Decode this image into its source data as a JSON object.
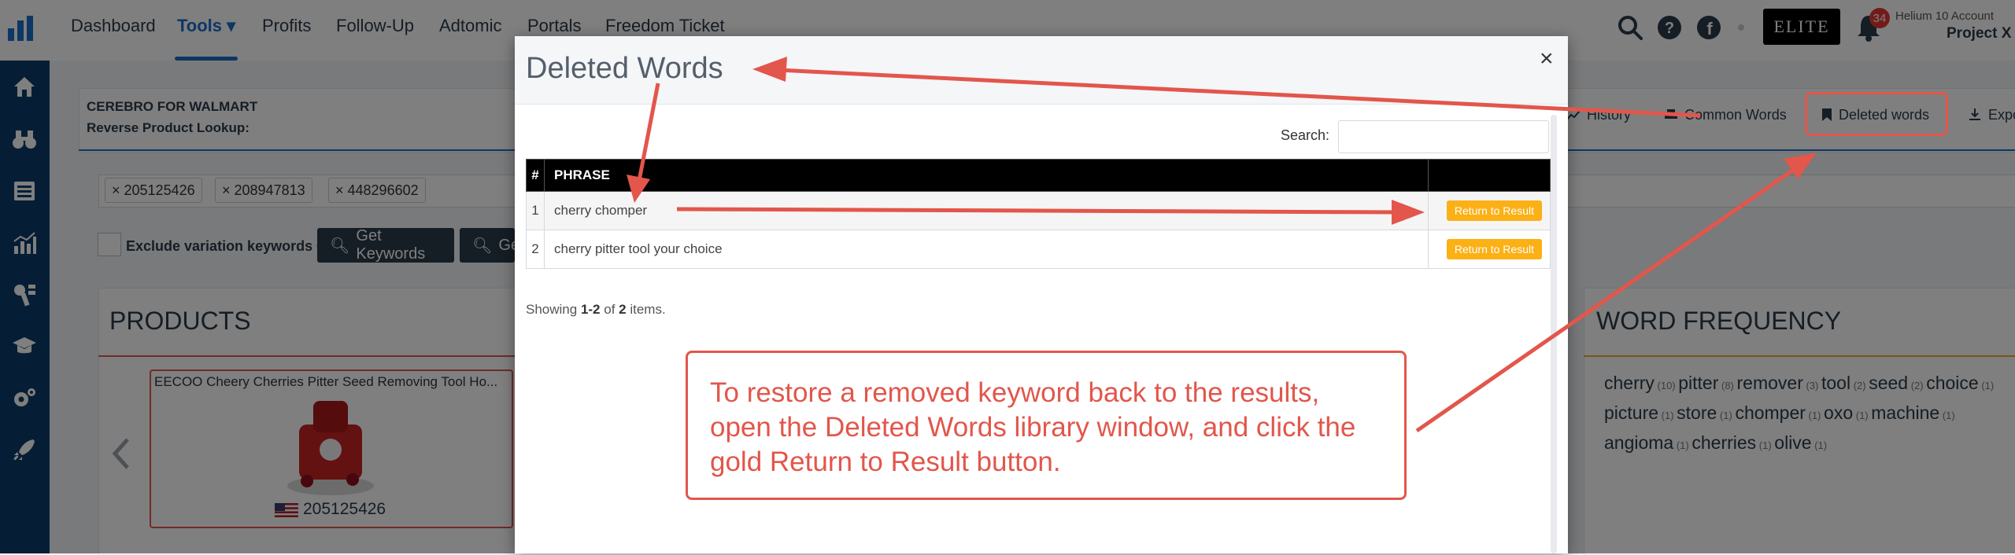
{
  "topnav": {
    "items": [
      "Dashboard",
      "Tools",
      "Profits",
      "Follow-Up",
      "Adtomic",
      "Portals",
      "Freedom Ticket"
    ],
    "elite_label": "ELITE",
    "notification_count": "34",
    "account_label": "Helium 10 Account",
    "account_name": "Project X"
  },
  "tool": {
    "title": "CEREBRO FOR WALMART",
    "subtitle": "Reverse Product Lookup:",
    "tabs": {
      "history": "History",
      "common_words": "Common Words",
      "deleted_words": "Deleted words",
      "export": "Expo"
    },
    "tags": [
      "× 205125426",
      "× 208947813",
      "× 448296602"
    ],
    "exclude_label": "Exclude variation keywords",
    "get_keywords": "Get Keywords",
    "get_partial": "Ge"
  },
  "products": {
    "title": "PRODUCTS",
    "card_title": "EECOO Cheery Cherries Pitter Seed Removing Tool Ho...",
    "card_id": "205125426"
  },
  "word_frequency": {
    "title": "WORD FREQUENCY",
    "words": [
      {
        "w": "cherry",
        "c": "(10)"
      },
      {
        "w": "pitter",
        "c": "(8)"
      },
      {
        "w": "remover",
        "c": "(3)"
      },
      {
        "w": "tool",
        "c": "(2)"
      },
      {
        "w": "seed",
        "c": "(2)"
      },
      {
        "w": "choice",
        "c": "(1)"
      },
      {
        "w": "picture",
        "c": "(1)"
      },
      {
        "w": "store",
        "c": "(1)"
      },
      {
        "w": "chomper",
        "c": "(1)"
      },
      {
        "w": "oxo",
        "c": "(1)"
      },
      {
        "w": "machine",
        "c": "(1)"
      },
      {
        "w": "angioma",
        "c": "(1)"
      },
      {
        "w": "cherries",
        "c": "(1)"
      },
      {
        "w": "olive",
        "c": "(1)"
      }
    ]
  },
  "modal": {
    "title": "Deleted Words",
    "close": "×",
    "search_label": "Search:",
    "search_value": "",
    "columns": [
      "#",
      "PHRASE",
      ""
    ],
    "rows": [
      {
        "num": "1",
        "phrase": "cherry chomper",
        "action": "Return to Result"
      },
      {
        "num": "2",
        "phrase": "cherry pitter tool your choice",
        "action": "Return to Result"
      }
    ],
    "showing_prefix": "Showing ",
    "showing_range": "1-2",
    "showing_mid": " of ",
    "showing_total": "2",
    "showing_suffix": " items."
  },
  "annotation": {
    "text": "To restore a removed keyword back to the results, open the Deleted Words library window, and click the gold Return to Result button.",
    "color": "#e2564b"
  }
}
